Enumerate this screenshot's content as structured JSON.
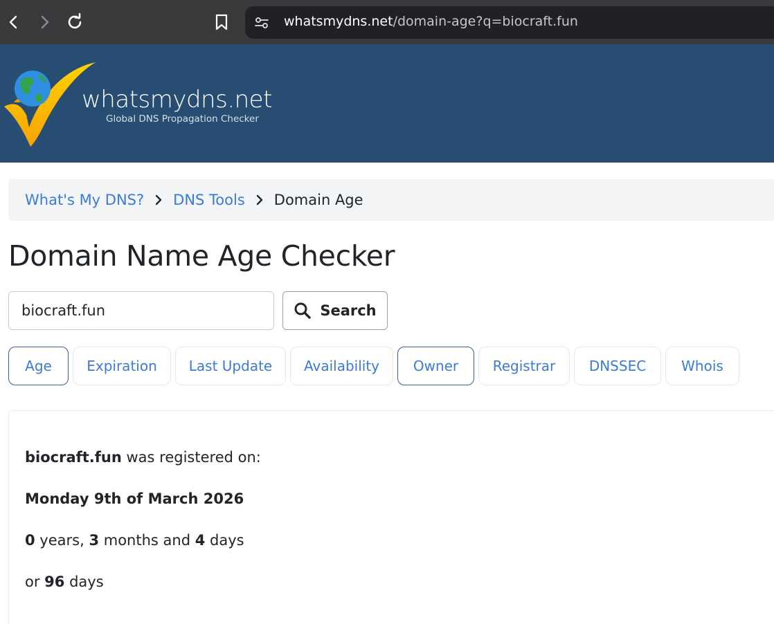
{
  "browser": {
    "url_host": "whatsmydns.net",
    "url_path": "/domain-age?q=biocraft.fun",
    "chrome_color": "#3a3a3c"
  },
  "header": {
    "logo_text": "whatsmydns.net",
    "tagline": "Global DNS Propagation Checker",
    "bg_color": "#284d73"
  },
  "breadcrumb": {
    "items": [
      "What's My DNS?",
      "DNS Tools"
    ],
    "current": "Domain Age"
  },
  "page_title": "Domain Name Age Checker",
  "search": {
    "value": "biocraft.fun",
    "button_label": "Search"
  },
  "tabs": [
    {
      "label": "Age",
      "active": true
    },
    {
      "label": "Expiration",
      "active": false
    },
    {
      "label": "Last Update",
      "active": false
    },
    {
      "label": "Availability",
      "active": false
    },
    {
      "label": "Owner",
      "active": true
    },
    {
      "label": "Registrar",
      "active": false
    },
    {
      "label": "DNSSEC",
      "active": false
    },
    {
      "label": "Whois",
      "active": false
    }
  ],
  "result": {
    "domain": "biocraft.fun",
    "registered_suffix": " was registered on:",
    "date": "Monday 9th of March 2026",
    "years": "0",
    "years_label": " years, ",
    "months": "3",
    "months_label": " months and ",
    "days": "4",
    "days_label": " days",
    "or_label": "or ",
    "total_days": "96",
    "total_days_label": " days"
  },
  "accent_color": "#3b7bd6"
}
